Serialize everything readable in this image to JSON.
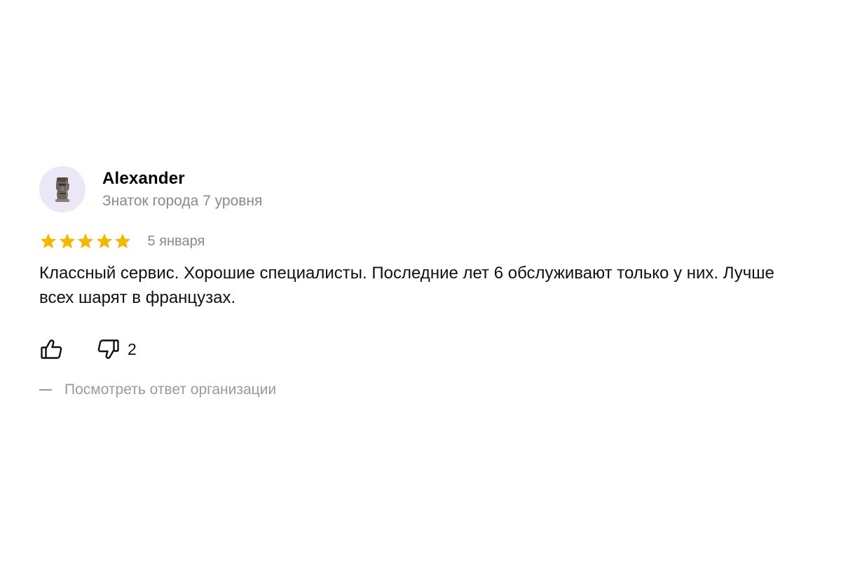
{
  "review": {
    "author": {
      "name": "Alexander",
      "level": "Знаток города 7 уровня",
      "avatar_icon": "moai-statue-icon"
    },
    "rating": {
      "stars": 5,
      "max": 5,
      "star_color": "#f5b800"
    },
    "date": "5 января",
    "text": "Классный сервис. Хорошие специалисты. Последние лет 6 обслуживают только у них. Лучше всех шарят в французах.",
    "actions": {
      "like_icon": "thumbs-up-icon",
      "dislike_icon": "thumbs-down-icon",
      "dislike_count": "2"
    },
    "org_reply_link": "Посмотреть ответ организации"
  }
}
